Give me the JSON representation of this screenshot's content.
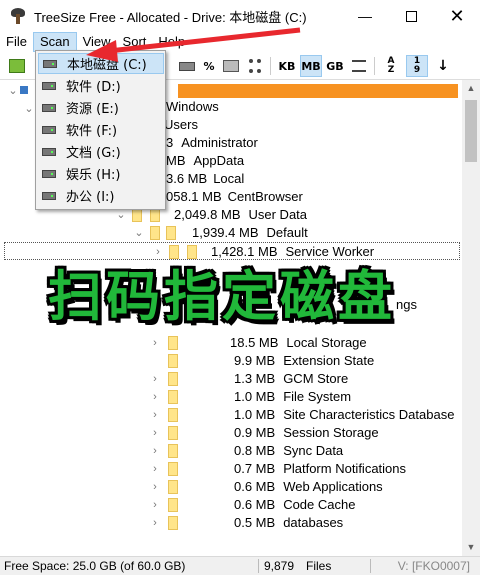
{
  "window": {
    "title": "TreeSize Free - Allocated - Drive: 本地磁盘 (C:)",
    "controls": [
      "minimize-icon",
      "maximize-icon",
      "close-icon"
    ]
  },
  "menubar": {
    "file": "File",
    "scan": "Scan",
    "view": "View",
    "sort": "Sort",
    "help": "Help"
  },
  "toolbar": {
    "percent": "%",
    "kb": "KB",
    "mb": "MB",
    "gb": "GB",
    "sort_az": "A Z",
    "sort_19": "1 9",
    "down": "↓"
  },
  "scan_menu": {
    "items": [
      {
        "label": "本地磁盘 (C:)"
      },
      {
        "label": "软件 (D:)"
      },
      {
        "label": "资源 (E:)"
      },
      {
        "label": "软件 (F:)"
      },
      {
        "label": "文档 (G:)"
      },
      {
        "label": "娱乐 (H:)"
      },
      {
        "label": "办公 (I:)"
      }
    ]
  },
  "tree": {
    "rows": [
      {
        "size": "",
        "name": "Windows"
      },
      {
        "size": "",
        "name": "Users"
      },
      {
        "size": "3",
        "name": "Administrator"
      },
      {
        "size": "MB",
        "name": "AppData"
      },
      {
        "size": "3.6 MB",
        "name": "Local"
      },
      {
        "size": "058.1 MB",
        "name": "CentBrowser"
      },
      {
        "size": "2,049.8 MB",
        "name": "User Data"
      },
      {
        "size": "1,939.4 MB",
        "name": "Default"
      },
      {
        "size": "1,428.1 MB",
        "name": "Service Worker"
      },
      {
        "size": "",
        "name": "ngs"
      },
      {
        "size": "18.5 MB",
        "name": "Local Storage"
      },
      {
        "size": "9.9 MB",
        "name": "Extension State"
      },
      {
        "size": "1.3 MB",
        "name": "GCM Store"
      },
      {
        "size": "1.0 MB",
        "name": "File System"
      },
      {
        "size": "1.0 MB",
        "name": "Site Characteristics Database"
      },
      {
        "size": "0.9 MB",
        "name": "Session Storage"
      },
      {
        "size": "0.8 MB",
        "name": "Sync Data"
      },
      {
        "size": "0.7 MB",
        "name": "Platform Notifications"
      },
      {
        "size": "0.6 MB",
        "name": "Web Applications"
      },
      {
        "size": "0.6 MB",
        "name": "Code Cache"
      },
      {
        "size": "0.5 MB",
        "name": "databases"
      }
    ]
  },
  "overlay_text": "扫码指定磁盘",
  "statusbar": {
    "free_space": "Free Space: 25.0 GB  (of 60.0 GB)",
    "files_count": "9,879",
    "files_label": "Files",
    "watermark": "V: [FKO0007]"
  },
  "colors": {
    "accent": "#f79221",
    "overlay_text": "#21b83a",
    "arrow": "#e8282e",
    "folder": "#ffe58a",
    "highlight": "#cce4f7"
  }
}
